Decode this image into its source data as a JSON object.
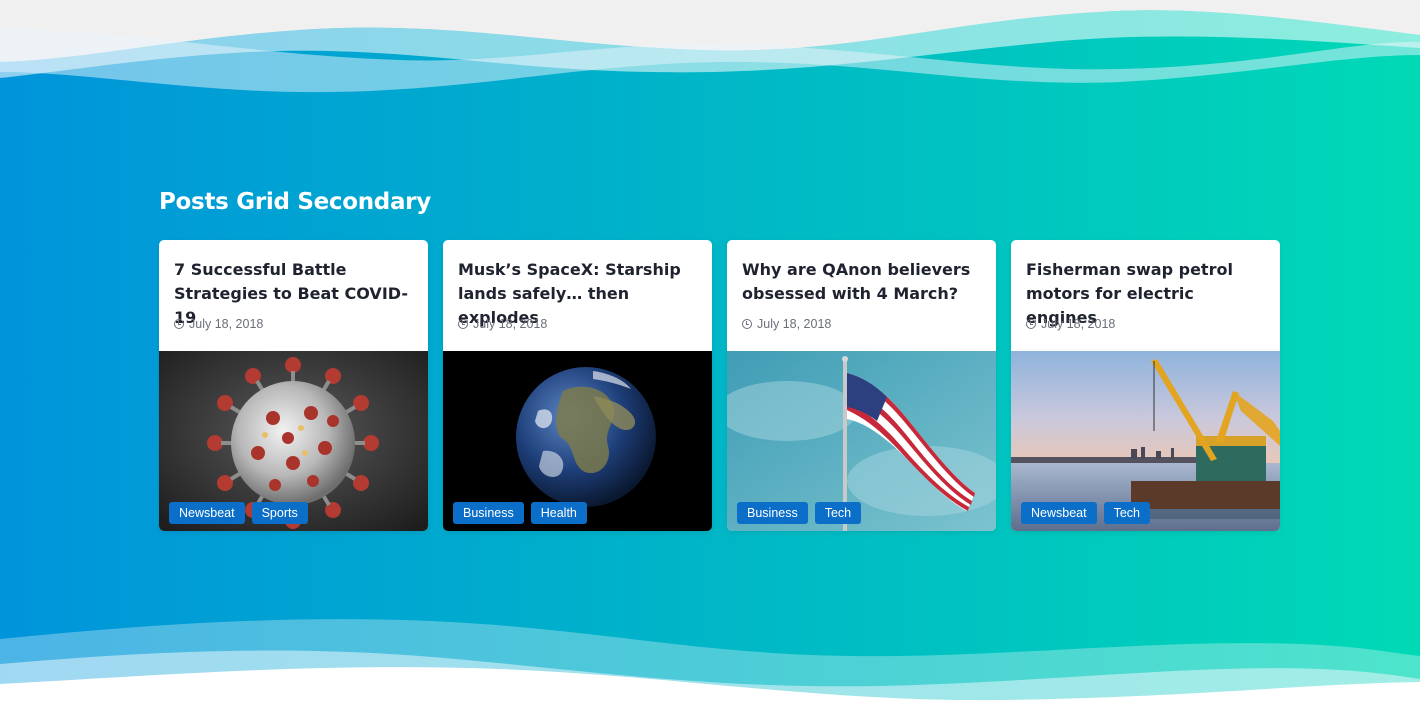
{
  "section": {
    "title": "Posts Grid Secondary"
  },
  "posts": [
    {
      "title": "7 Successful Battle Strategies to Beat COVID-19",
      "date": "July 18, 2018",
      "image": "coronavirus",
      "tags": [
        "Newsbeat",
        "Sports"
      ]
    },
    {
      "title": "Musk’s SpaceX: Starship lands safely… then explodes",
      "date": "July 18, 2018",
      "image": "earth-from-space",
      "tags": [
        "Business",
        "Health"
      ]
    },
    {
      "title": "Why are QAnon believers obsessed with 4 March?",
      "date": "July 18, 2018",
      "image": "american-flag",
      "tags": [
        "Business",
        "Tech"
      ]
    },
    {
      "title": "Fisherman swap petrol motors for electric engines",
      "date": "July 18, 2018",
      "image": "crane-barge",
      "tags": [
        "Newsbeat",
        "Tech"
      ]
    }
  ],
  "colors": {
    "gradient_start": "#0094db",
    "gradient_end": "#00d9b6",
    "tag": "#0b6fc9",
    "title": "#1f2330"
  }
}
